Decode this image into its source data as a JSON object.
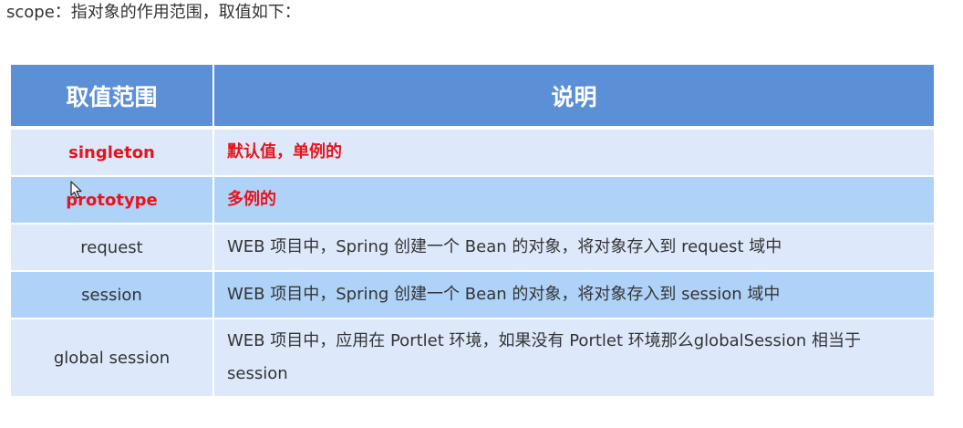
{
  "intro_text": "scope：指对象的作用范围，取值如下：",
  "table": {
    "headers": [
      "取值范围",
      "说明"
    ],
    "rows": [
      {
        "name": "singleton",
        "desc": "默认值，单例的"
      },
      {
        "name": "prototype",
        "desc": "多例的"
      },
      {
        "name": "request",
        "desc": "WEB 项目中，Spring 创建一个 Bean 的对象，将对象存入到 request 域中"
      },
      {
        "name": "session",
        "desc": "WEB 项目中，Spring 创建一个 Bean 的对象，将对象存入到 session 域中"
      },
      {
        "name": "global session",
        "desc": "WEB 项目中，应用在 Portlet 环境，如果没有 Portlet 环境那么globalSession 相当于 session"
      }
    ]
  },
  "colors": {
    "header_bg": "#5b8fd6",
    "row_light": "#dde9fb",
    "row_dark": "#afd2f8",
    "emphasis_text": "#e8141b"
  },
  "icons": {
    "cursor": "mouse-pointer-icon"
  }
}
